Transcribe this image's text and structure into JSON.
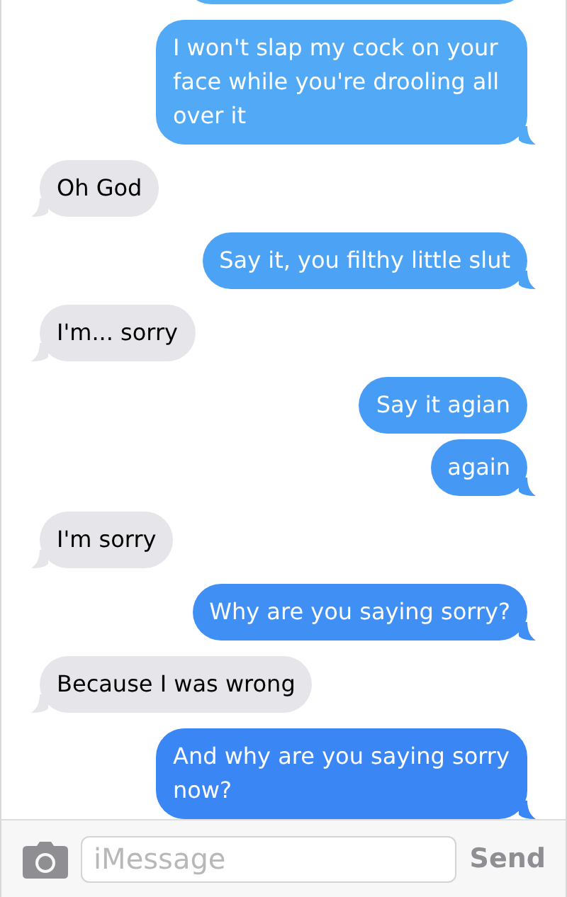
{
  "messages": [
    {
      "kind": "cut",
      "tail": false,
      "color": "#56aef6"
    },
    {
      "kind": "sent",
      "text": "I won't slap my cock on your face while you're drooling all over it",
      "tail": true,
      "color": "#52aaf6"
    },
    {
      "kind": "received",
      "text": "Oh God",
      "tail": true,
      "color": "#e5e5ea"
    },
    {
      "kind": "sent",
      "text": "Say it, you filthy little slut",
      "tail": true,
      "color": "#4ca3f5"
    },
    {
      "kind": "received",
      "text": "I'm... sorry",
      "tail": true,
      "color": "#e5e5ea"
    },
    {
      "kind": "sent",
      "text": "Say it agian",
      "tail": false,
      "color": "#479cf5"
    },
    {
      "kind": "sent",
      "text": "again",
      "tail": true,
      "color": "#4599f5"
    },
    {
      "kind": "received",
      "text": "I'm sorry",
      "tail": true,
      "color": "#e5e5ea"
    },
    {
      "kind": "sent",
      "text": "Why are you saying sorry?",
      "tail": true,
      "color": "#3f8ff5"
    },
    {
      "kind": "received",
      "text": "Because I was wrong",
      "tail": true,
      "color": "#e5e5ea"
    },
    {
      "kind": "sent",
      "text": "And why are you saying sorry now?",
      "tail": true,
      "color": "#3a86f5"
    }
  ],
  "composer": {
    "placeholder": "iMessage",
    "send": "Send"
  }
}
